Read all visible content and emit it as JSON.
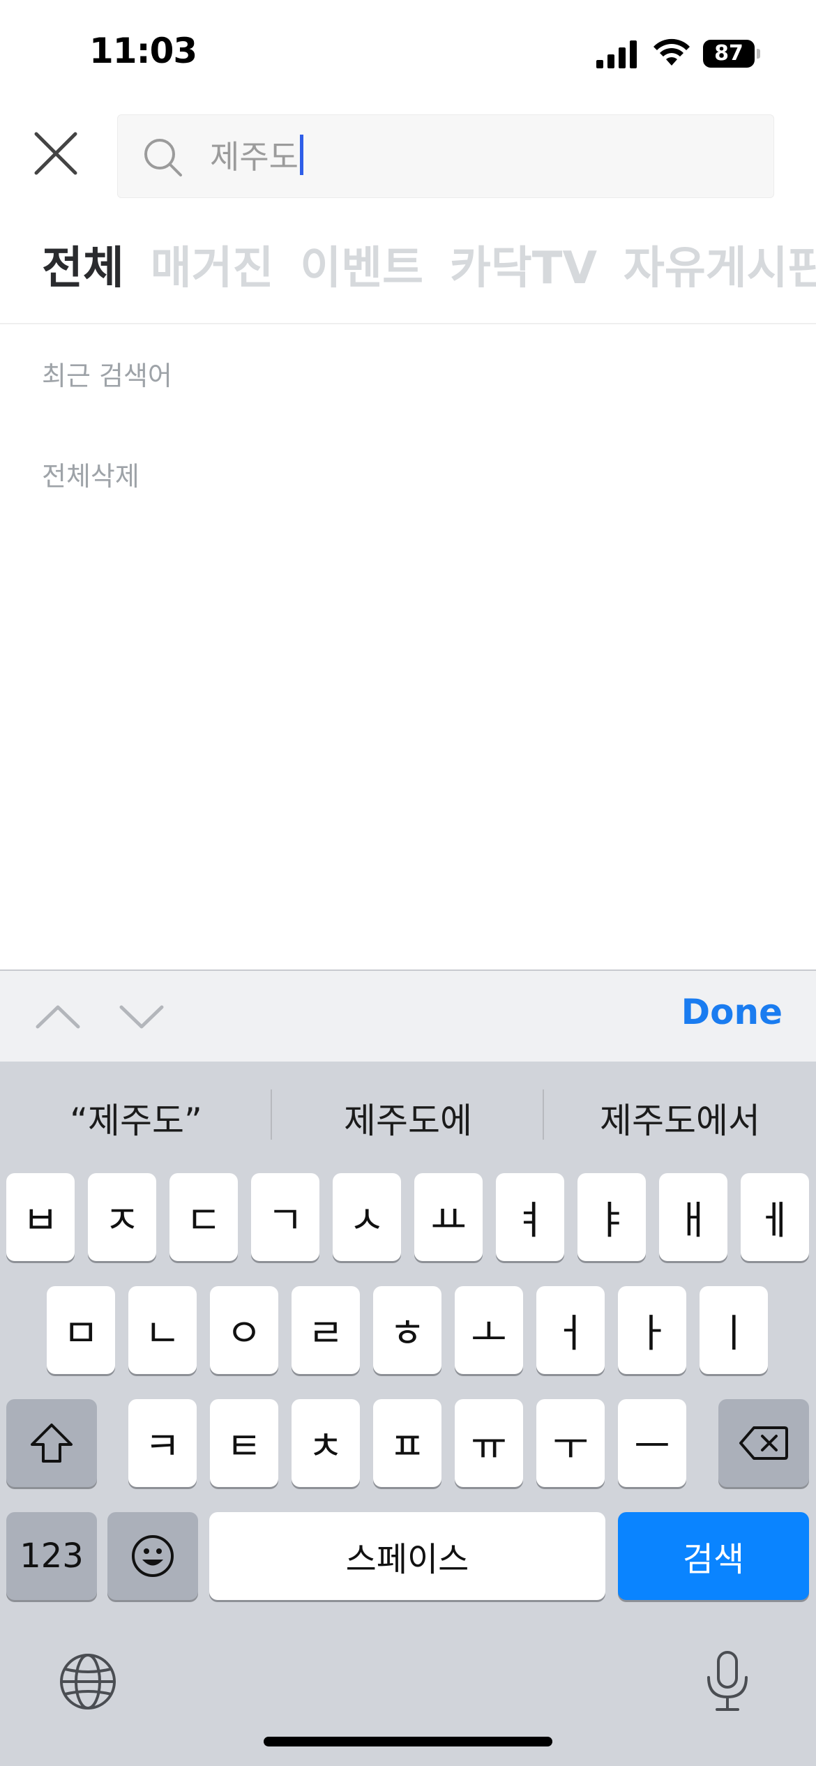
{
  "status_bar": {
    "time": "11:03",
    "battery": "87"
  },
  "search": {
    "query": "제주도"
  },
  "tabs": [
    {
      "label": "전체",
      "active": true
    },
    {
      "label": "매거진",
      "active": false
    },
    {
      "label": "이벤트",
      "active": false
    },
    {
      "label": "카닥TV",
      "active": false
    },
    {
      "label": "자유게시판",
      "active": false
    }
  ],
  "recent": {
    "label": "최근 검색어",
    "clear_all": "전체삭제"
  },
  "accessory": {
    "done": "Done"
  },
  "keyboard": {
    "suggestions": [
      "“제주도”",
      "제주도에",
      "제주도에서"
    ],
    "row1": [
      "ㅂ",
      "ㅈ",
      "ㄷ",
      "ㄱ",
      "ㅅ",
      "ㅛ",
      "ㅕ",
      "ㅑ",
      "ㅐ",
      "ㅔ"
    ],
    "row2": [
      "ㅁ",
      "ㄴ",
      "ㅇ",
      "ㄹ",
      "ㅎ",
      "ㅗ",
      "ㅓ",
      "ㅏ",
      "ㅣ"
    ],
    "row3": [
      "ㅋ",
      "ㅌ",
      "ㅊ",
      "ㅍ",
      "ㅠ",
      "ㅜ",
      "ㅡ"
    ],
    "numbers": "123",
    "space": "스페이스",
    "search": "검색"
  },
  "icons": {
    "close": "close-icon",
    "search": "search-icon",
    "shift": "shift-icon",
    "delete": "backspace-icon",
    "emoji": "emoji-icon",
    "globe": "globe-icon",
    "mic": "microphone-icon",
    "up": "chevron-up-icon",
    "down": "chevron-down-icon"
  },
  "colors": {
    "accent": "#0a84ff",
    "done": "#1a7cf0",
    "cursor": "#2f5ee8",
    "tab_active": "#2a2b2e",
    "tab_inactive": "#d6d9dc"
  }
}
